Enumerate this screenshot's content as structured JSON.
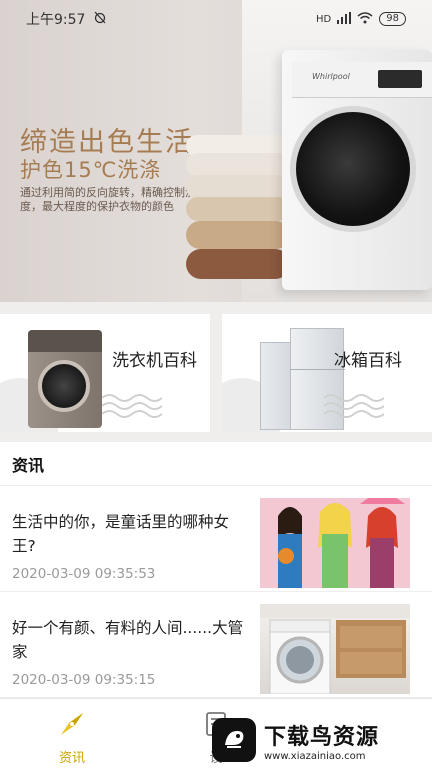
{
  "status_bar": {
    "time": "上午9:57",
    "signal": "HD",
    "battery": "98"
  },
  "banner": {
    "title": "缔造出色生活",
    "subtitle": "护色15℃洗涤",
    "description": "通过利用简的反向旋转，精确控制洗涤角度与力度，最大程度的保护衣物的颜色",
    "brand": "Whirlpool"
  },
  "categories": [
    {
      "label": "洗衣机百科",
      "icon": "washing-machine"
    },
    {
      "label": "冰箱百科",
      "icon": "refrigerator"
    }
  ],
  "news": {
    "header": "资讯",
    "items": [
      {
        "title": "生活中的你，是童话里的哪种女王?",
        "date": "2020-03-09 09:35:53",
        "thumb": "illustration-queens"
      },
      {
        "title": "好一个有颜、有料的人间......大管家",
        "date": "2020-03-09 09:35:15",
        "thumb": "washer-in-kitchen"
      }
    ]
  },
  "tabbar": {
    "tabs": [
      {
        "label": "资讯",
        "active": true,
        "icon": "compass-icon"
      },
      {
        "label": "设",
        "active": false,
        "icon": "device-icon"
      }
    ],
    "accent": "#c9a400"
  },
  "watermark": {
    "main": "下载鸟资源",
    "sub": "www.xiazainiao.com"
  }
}
